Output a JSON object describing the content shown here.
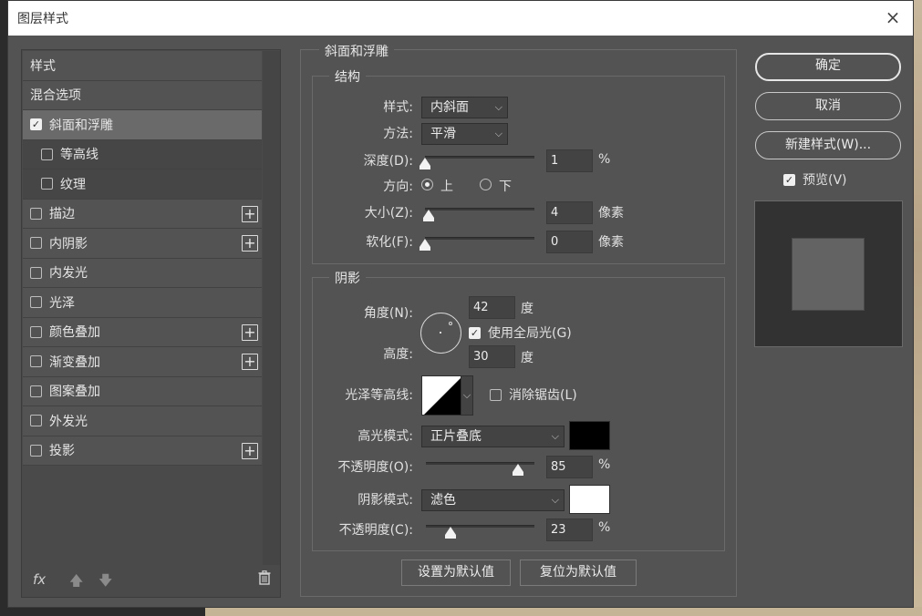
{
  "window": {
    "title": "图层样式",
    "close_icon": "×"
  },
  "styles_list": {
    "items": [
      {
        "label": "样式",
        "checkbox": false,
        "checked": false,
        "plus": false,
        "sub": false,
        "selected": false
      },
      {
        "label": "混合选项",
        "checkbox": false,
        "checked": false,
        "plus": false,
        "sub": false,
        "selected": false
      },
      {
        "label": "斜面和浮雕",
        "checkbox": true,
        "checked": true,
        "plus": false,
        "sub": false,
        "selected": true
      },
      {
        "label": "等高线",
        "checkbox": true,
        "checked": false,
        "plus": false,
        "sub": true,
        "selected": false
      },
      {
        "label": "纹理",
        "checkbox": true,
        "checked": false,
        "plus": false,
        "sub": true,
        "selected": false
      },
      {
        "label": "描边",
        "checkbox": true,
        "checked": false,
        "plus": true,
        "sub": false,
        "selected": false
      },
      {
        "label": "内阴影",
        "checkbox": true,
        "checked": false,
        "plus": true,
        "sub": false,
        "selected": false
      },
      {
        "label": "内发光",
        "checkbox": true,
        "checked": false,
        "plus": false,
        "sub": false,
        "selected": false
      },
      {
        "label": "光泽",
        "checkbox": true,
        "checked": false,
        "plus": false,
        "sub": false,
        "selected": false
      },
      {
        "label": "颜色叠加",
        "checkbox": true,
        "checked": false,
        "plus": true,
        "sub": false,
        "selected": false
      },
      {
        "label": "渐变叠加",
        "checkbox": true,
        "checked": false,
        "plus": true,
        "sub": false,
        "selected": false
      },
      {
        "label": "图案叠加",
        "checkbox": true,
        "checked": false,
        "plus": false,
        "sub": false,
        "selected": false
      },
      {
        "label": "外发光",
        "checkbox": true,
        "checked": false,
        "plus": false,
        "sub": false,
        "selected": false
      },
      {
        "label": "投影",
        "checkbox": true,
        "checked": false,
        "plus": true,
        "sub": false,
        "selected": false
      }
    ],
    "footer": {
      "fx_label": "fx",
      "up_icon": "arrow-up-icon",
      "down_icon": "arrow-down-icon",
      "trash_icon": "trash-icon"
    }
  },
  "bevel": {
    "title": "斜面和浮雕",
    "structure": {
      "title": "结构",
      "style_label": "样式:",
      "style_value": "内斜面",
      "technique_label": "方法:",
      "technique_value": "平滑",
      "depth_label": "深度(D):",
      "depth_value": "1",
      "depth_fraction": 0.0,
      "depth_unit": "%",
      "direction_label": "方向:",
      "direction_up": "上",
      "direction_down": "下",
      "direction_selected": "上",
      "size_label": "大小(Z):",
      "size_value": "4",
      "size_fraction": 0.03,
      "size_unit": "像素",
      "soften_label": "软化(F):",
      "soften_value": "0",
      "soften_fraction": 0.0,
      "soften_unit": "像素"
    },
    "shading": {
      "title": "阴影",
      "angle_label": "角度(N):",
      "angle_value": "42",
      "angle_unit": "度",
      "global_light_label": "使用全局光(G)",
      "global_light_checked": true,
      "altitude_label": "高度:",
      "altitude_value": "30",
      "altitude_unit": "度",
      "gloss_contour_label": "光泽等高线:",
      "anti_alias_label": "消除锯齿(L)",
      "anti_alias_checked": false,
      "highlight_mode_label": "高光模式:",
      "highlight_mode_value": "正片叠底",
      "highlight_color": "#000000",
      "highlight_opacity_label": "不透明度(O):",
      "highlight_opacity_value": "85",
      "highlight_opacity_fraction": 0.85,
      "highlight_opacity_unit": "%",
      "shadow_mode_label": "阴影模式:",
      "shadow_mode_value": "滤色",
      "shadow_color": "#ffffff",
      "shadow_opacity_label": "不透明度(C):",
      "shadow_opacity_value": "23",
      "shadow_opacity_fraction": 0.23,
      "shadow_opacity_unit": "%"
    },
    "make_default_label": "设置为默认值",
    "reset_default_label": "复位为默认值"
  },
  "actions": {
    "ok_label": "确定",
    "cancel_label": "取消",
    "new_style_label": "新建样式(W)...",
    "preview_label": "预览(V)",
    "preview_checked": true
  },
  "colors": {
    "dialog_bg": "#535353",
    "selected_row": "#6a6a6a"
  }
}
